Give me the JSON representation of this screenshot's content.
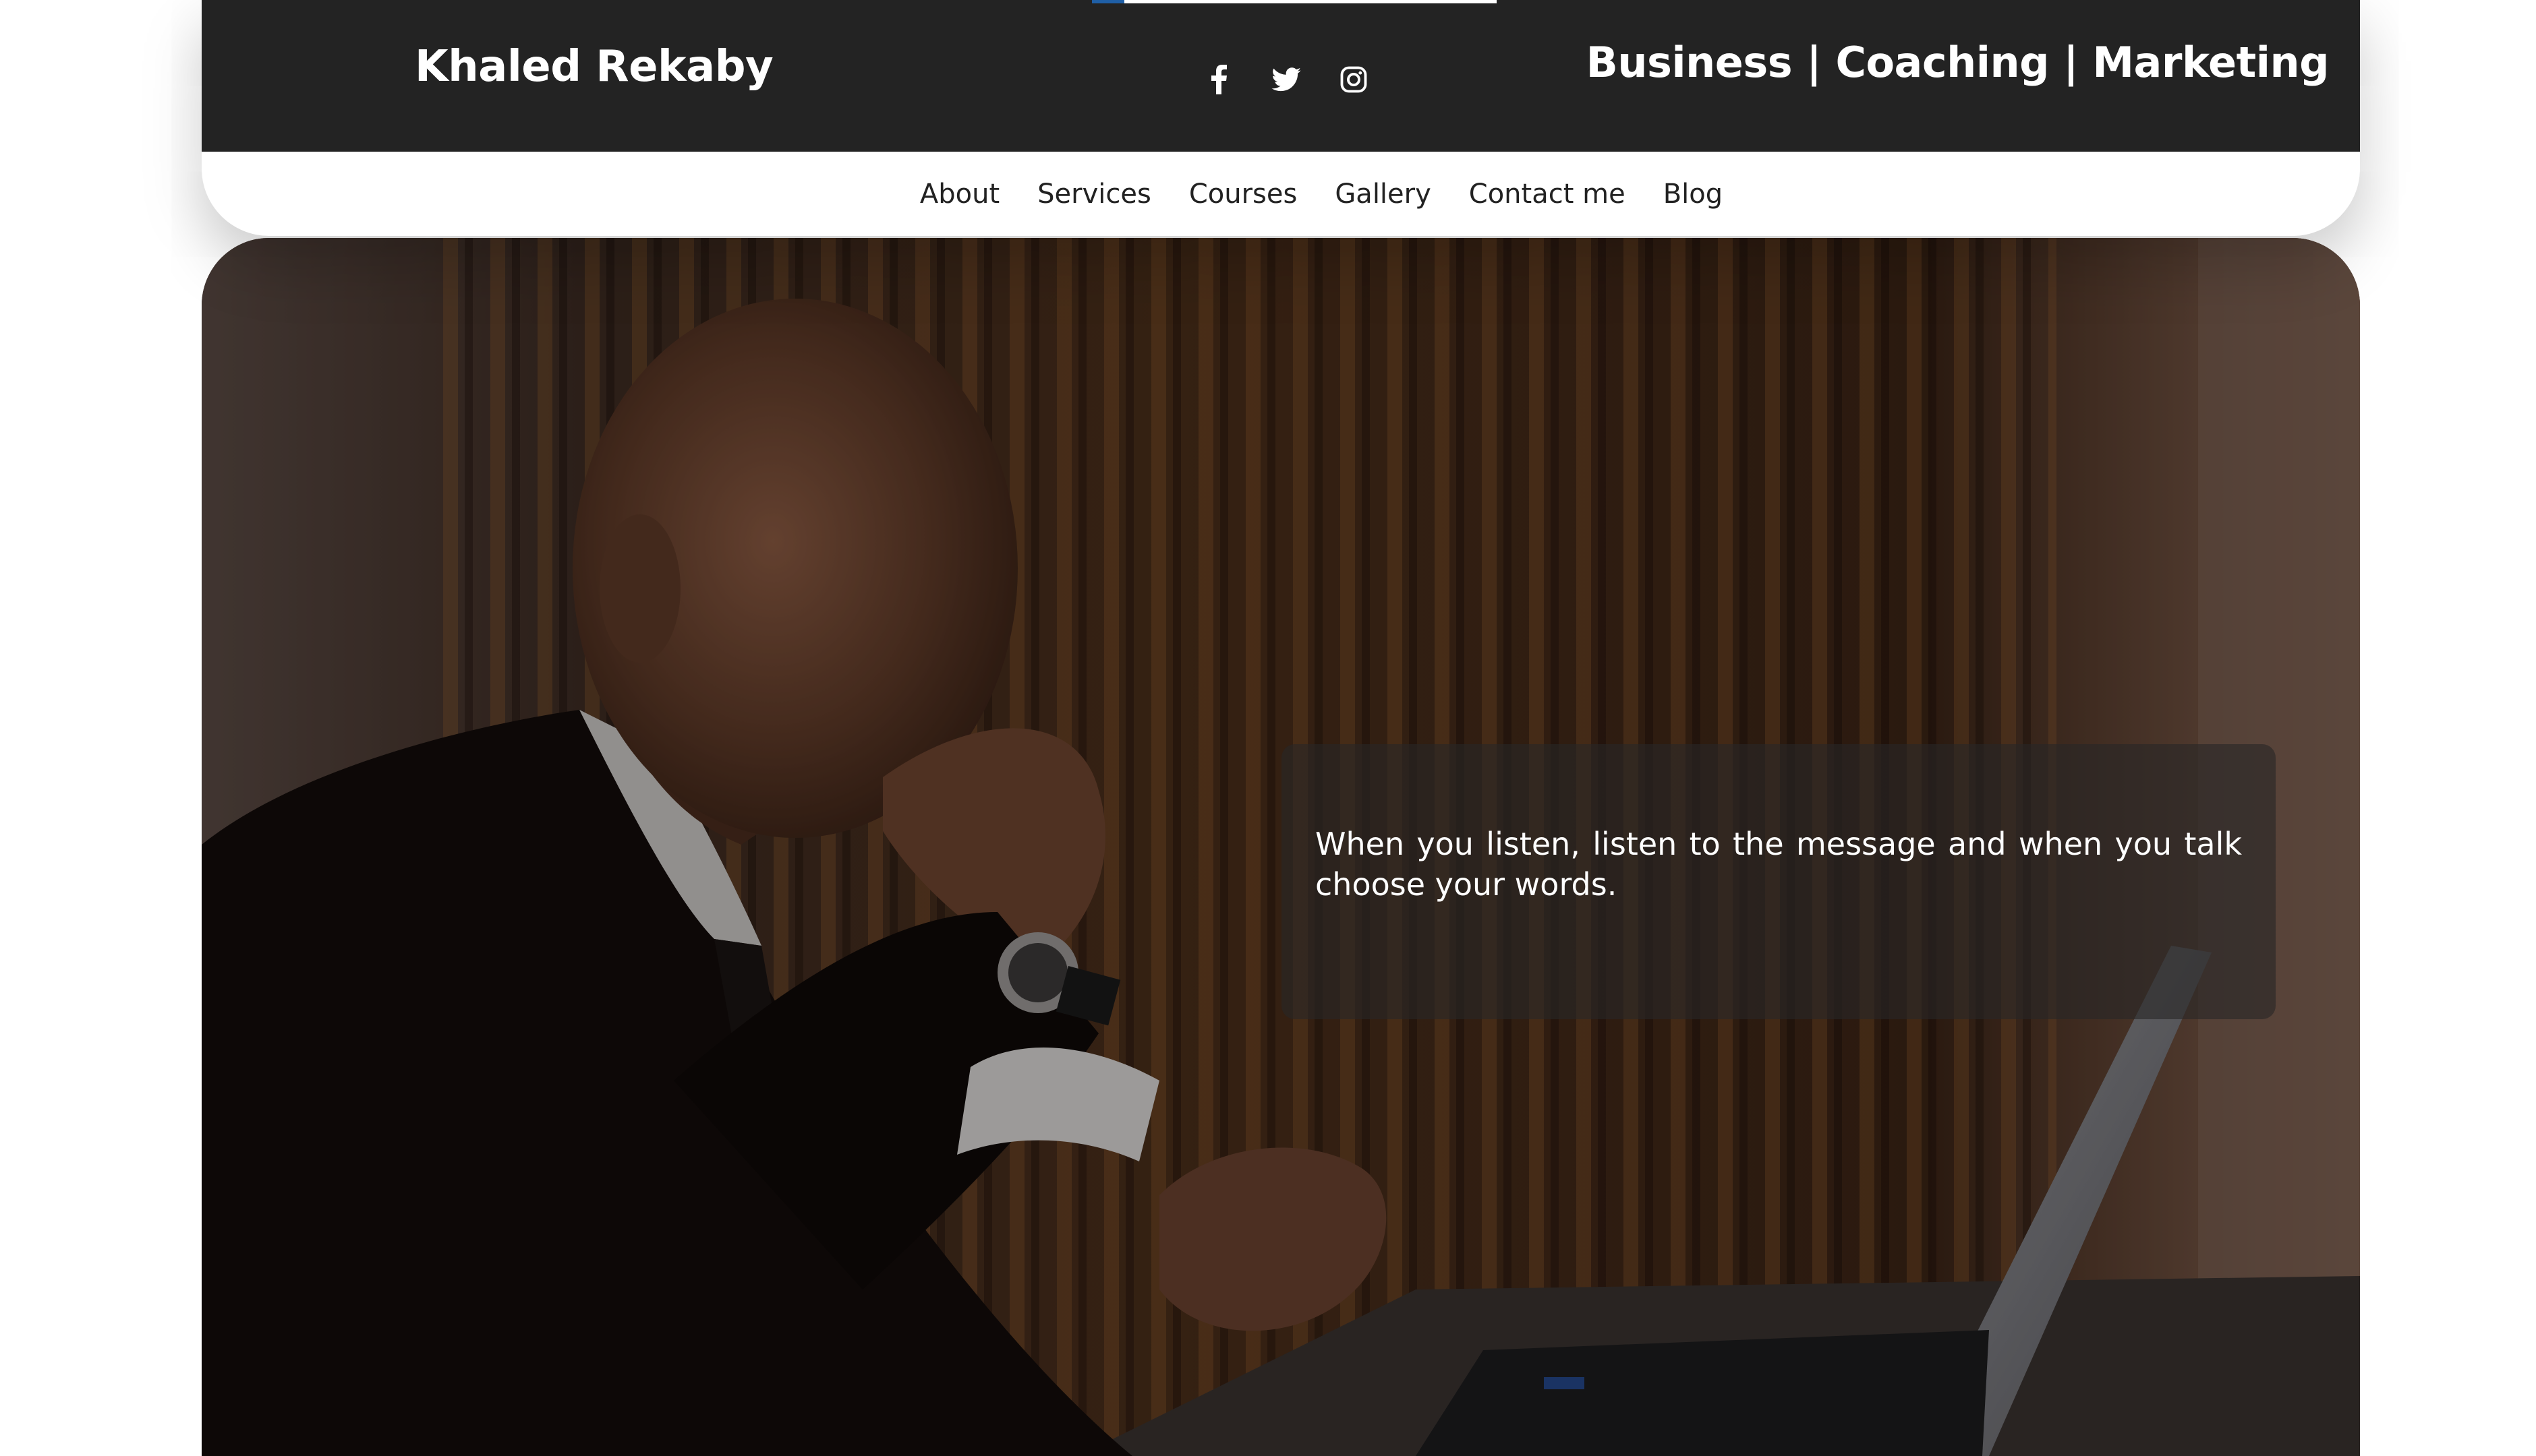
{
  "header": {
    "site_name": "Khaled Rekaby",
    "tagline": "Business | Coaching | Marketing",
    "progress_fraction": 0.08,
    "social": [
      {
        "name": "facebook",
        "icon": "facebook-icon"
      },
      {
        "name": "twitter",
        "icon": "twitter-icon"
      },
      {
        "name": "instagram",
        "icon": "instagram-icon"
      }
    ]
  },
  "nav": {
    "items": [
      "About",
      "Services",
      "Courses",
      "Gallery",
      "Contact me",
      "Blog"
    ]
  },
  "hero": {
    "quote": "When you listen, listen to the message and when you talk choose your words."
  },
  "colors": {
    "header_bg": "#232323",
    "progress_fill": "#1f5fa6",
    "nav_text": "#222222",
    "quote_overlay": "rgba(40,38,38,0.62)"
  }
}
